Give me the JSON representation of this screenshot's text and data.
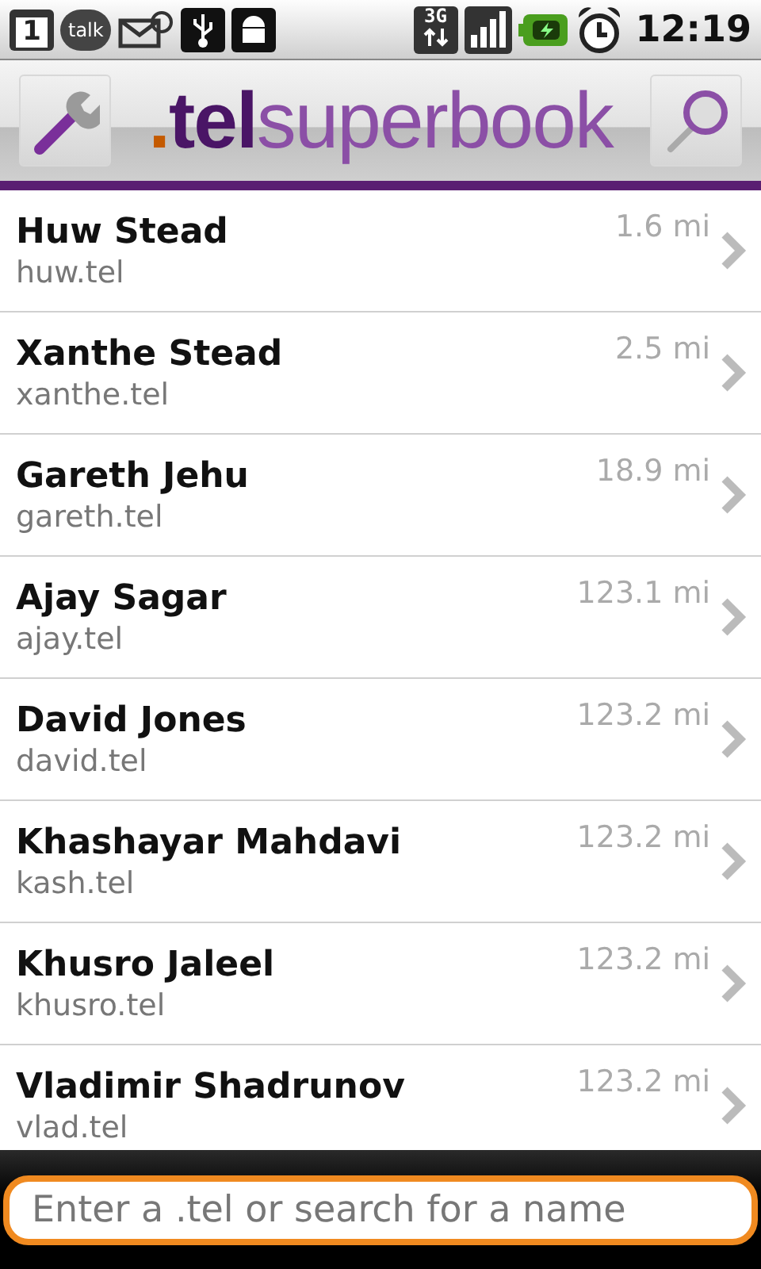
{
  "status_bar": {
    "calendar_day": "1",
    "chat_label": "talk",
    "network": "3G",
    "time": "12:19"
  },
  "header": {
    "logo": {
      "dot": ".",
      "prefix": "tel",
      "name": "superbook"
    }
  },
  "contacts": [
    {
      "name": "Huw Stead",
      "domain": "huw.tel",
      "distance": "1.6 mi"
    },
    {
      "name": "Xanthe Stead",
      "domain": "xanthe.tel",
      "distance": "2.5 mi"
    },
    {
      "name": "Gareth Jehu",
      "domain": "gareth.tel",
      "distance": "18.9 mi"
    },
    {
      "name": "Ajay Sagar",
      "domain": "ajay.tel",
      "distance": "123.1 mi"
    },
    {
      "name": "David Jones",
      "domain": "david.tel",
      "distance": "123.2 mi"
    },
    {
      "name": "Khashayar Mahdavi",
      "domain": "kash.tel",
      "distance": "123.2 mi"
    },
    {
      "name": "Khusro Jaleel",
      "domain": "khusro.tel",
      "distance": "123.2 mi"
    },
    {
      "name": "Vladimir Shadrunov",
      "domain": "vlad.tel",
      "distance": "123.2 mi"
    }
  ],
  "search": {
    "placeholder": "Enter a .tel or search for a name"
  }
}
